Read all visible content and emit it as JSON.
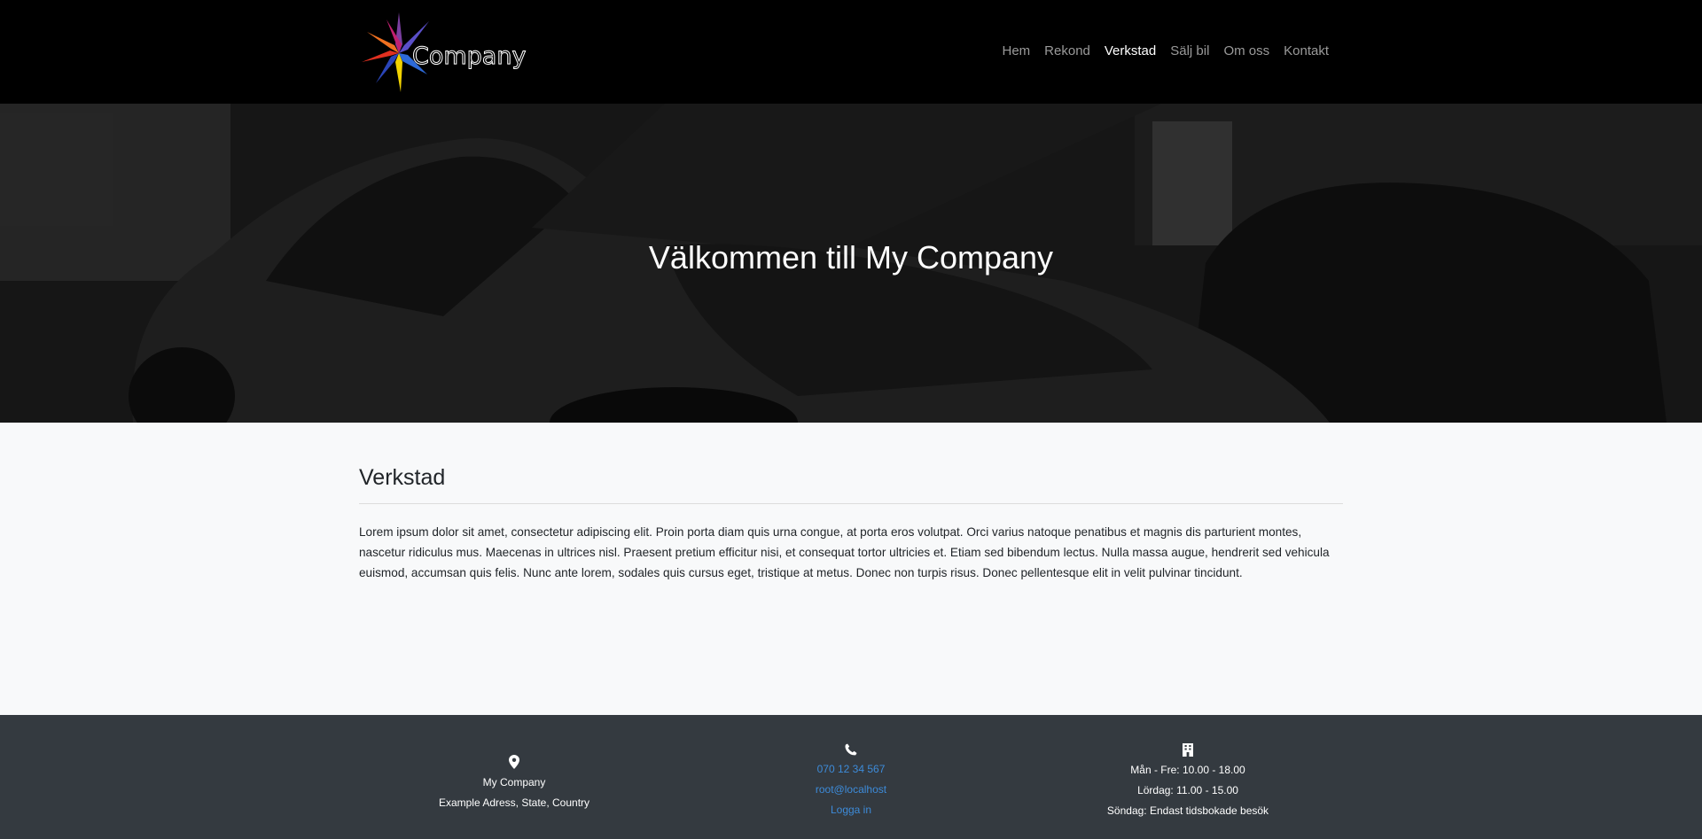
{
  "header": {
    "logo_text": "Company",
    "nav": [
      {
        "label": "Hem"
      },
      {
        "label": "Rekond"
      },
      {
        "label": "Verkstad",
        "active": true
      },
      {
        "label": "Sälj bil"
      },
      {
        "label": "Om oss"
      },
      {
        "label": "Kontakt"
      }
    ]
  },
  "hero": {
    "title": "Välkommen till My Company"
  },
  "main": {
    "heading": "Verkstad",
    "text": "Lorem ipsum dolor sit amet, consectetur adipiscing elit. Proin porta diam quis urna congue, at porta eros volutpat. Orci varius natoque penatibus et magnis dis parturient montes, nascetur ridiculus mus. Maecenas in ultrices nisl. Praesent pretium efficitur nisi, et consequat tortor ultricies et. Etiam sed bibendum lectus. Nulla massa augue, hendrerit sed vehicula euismod, accumsan quis felis. Nunc ante lorem, sodales quis cursus eget, tristique at metus. Donec non turpis risus. Donec pellentesque elit in velit pulvinar tincidunt."
  },
  "footer": {
    "address": {
      "icon": "map-marker-icon",
      "name": "My Company",
      "line": "Example Adress, State, Country"
    },
    "contact": {
      "icon": "phone-icon",
      "phone": "070 12 34 567",
      "email": "root@localhost",
      "login": "Logga in"
    },
    "hours": {
      "icon": "building-icon",
      "weekdays": "Mån - Fre: 10.00 - 18.00",
      "saturday": "Lördag: 11.00 - 15.00",
      "sunday": "Söndag: Endast tidsbokade besök"
    }
  },
  "colors": {
    "link": "#3d8bd9",
    "footer_bg": "#343a40",
    "navbar_bg": "#000000"
  }
}
